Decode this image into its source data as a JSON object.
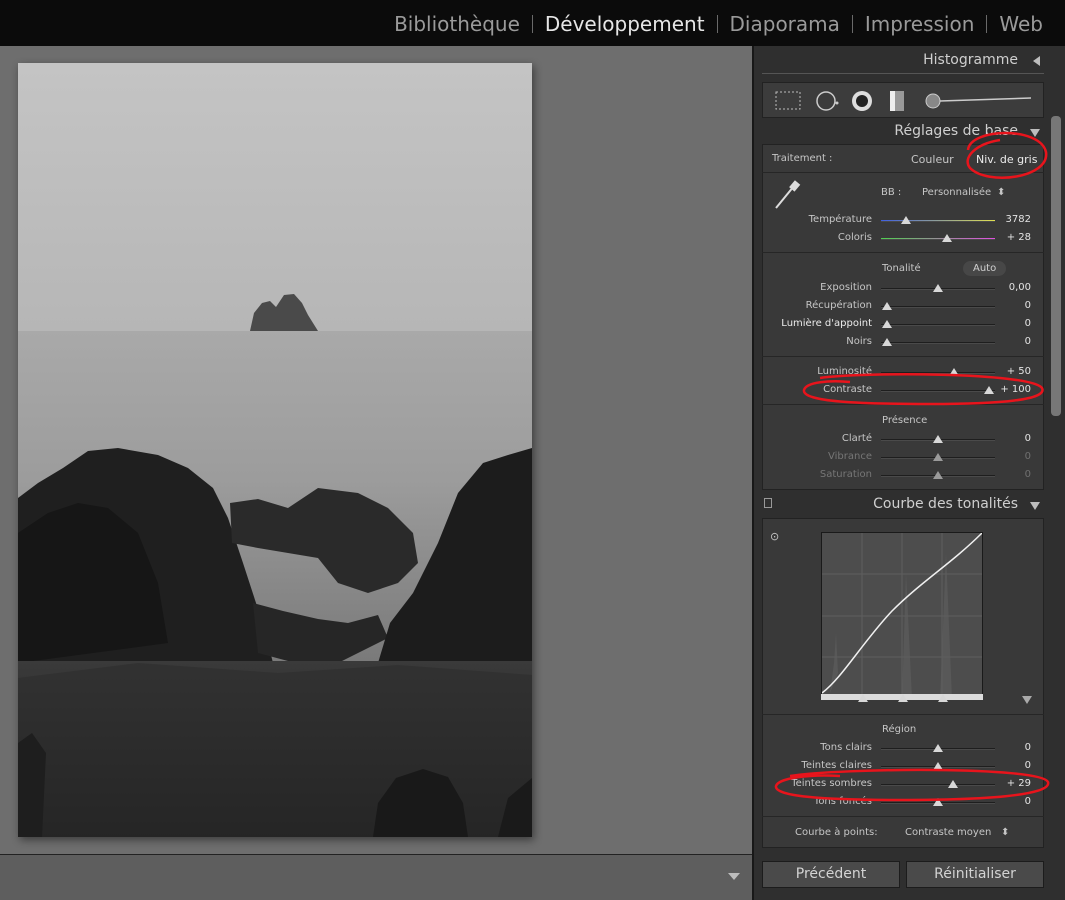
{
  "modules": [
    "Bibliothèque",
    "Développement",
    "Diaporama",
    "Impression",
    "Web"
  ],
  "active_module": "Développement",
  "panel": {
    "histogram_title": "Histogramme",
    "tools": [
      "crop-tool-icon",
      "spot-removal-icon",
      "red-eye-icon",
      "graduated-filter-icon",
      "adjustment-brush-icon"
    ],
    "basic": {
      "title": "Réglages de base",
      "treatment_label": "Traitement :",
      "color_option": "Couleur",
      "grayscale_option": "Niv. de gris",
      "wb_label": "BB :",
      "wb_value": "Personnalisée",
      "temperature": {
        "label": "Température",
        "value": "3782",
        "position": 0.22
      },
      "tint": {
        "label": "Coloris",
        "value": "+ 28",
        "position": 0.58
      },
      "tone_label": "Tonalité",
      "auto_label": "Auto",
      "exposure": {
        "label": "Exposition",
        "value": "0,00",
        "position": 0.5
      },
      "recovery": {
        "label": "Récupération",
        "value": "0",
        "position": 0.05
      },
      "fill_light": {
        "label": "Lumière d'appoint",
        "value": "0",
        "position": 0.05
      },
      "blacks": {
        "label": "Noirs",
        "value": "0",
        "position": 0.05
      },
      "brightness": {
        "label": "Luminosité",
        "value": "+ 50",
        "position": 0.64
      },
      "contrast": {
        "label": "Contraste",
        "value": "+ 100",
        "position": 0.95
      },
      "presence_label": "Présence",
      "clarity": {
        "label": "Clarté",
        "value": "0",
        "position": 0.5
      },
      "vibrance": {
        "label": "Vibrance",
        "value": "0",
        "position": 0.5
      },
      "saturation": {
        "label": "Saturation",
        "value": "0",
        "position": 0.5
      }
    },
    "tone_curve": {
      "title": "Courbe des tonalités",
      "region_label": "Région",
      "highlights": {
        "label": "Tons clairs",
        "value": "0",
        "position": 0.5
      },
      "lights": {
        "label": "Teintes claires",
        "value": "0",
        "position": 0.5
      },
      "darks": {
        "label": "Teintes sombres",
        "value": "+ 29",
        "position": 0.63
      },
      "shadows": {
        "label": "Tons foncés",
        "value": "0",
        "position": 0.5
      },
      "point_curve_label": "Courbe à points:",
      "point_curve_value": "Contraste moyen"
    },
    "previous_button": "Précédent",
    "reset_button": "Réinitialiser"
  },
  "colors": {
    "annotation": "#e8141c",
    "panel_bg": "#2f2f2f",
    "main_bg": "#6e6e6e"
  }
}
